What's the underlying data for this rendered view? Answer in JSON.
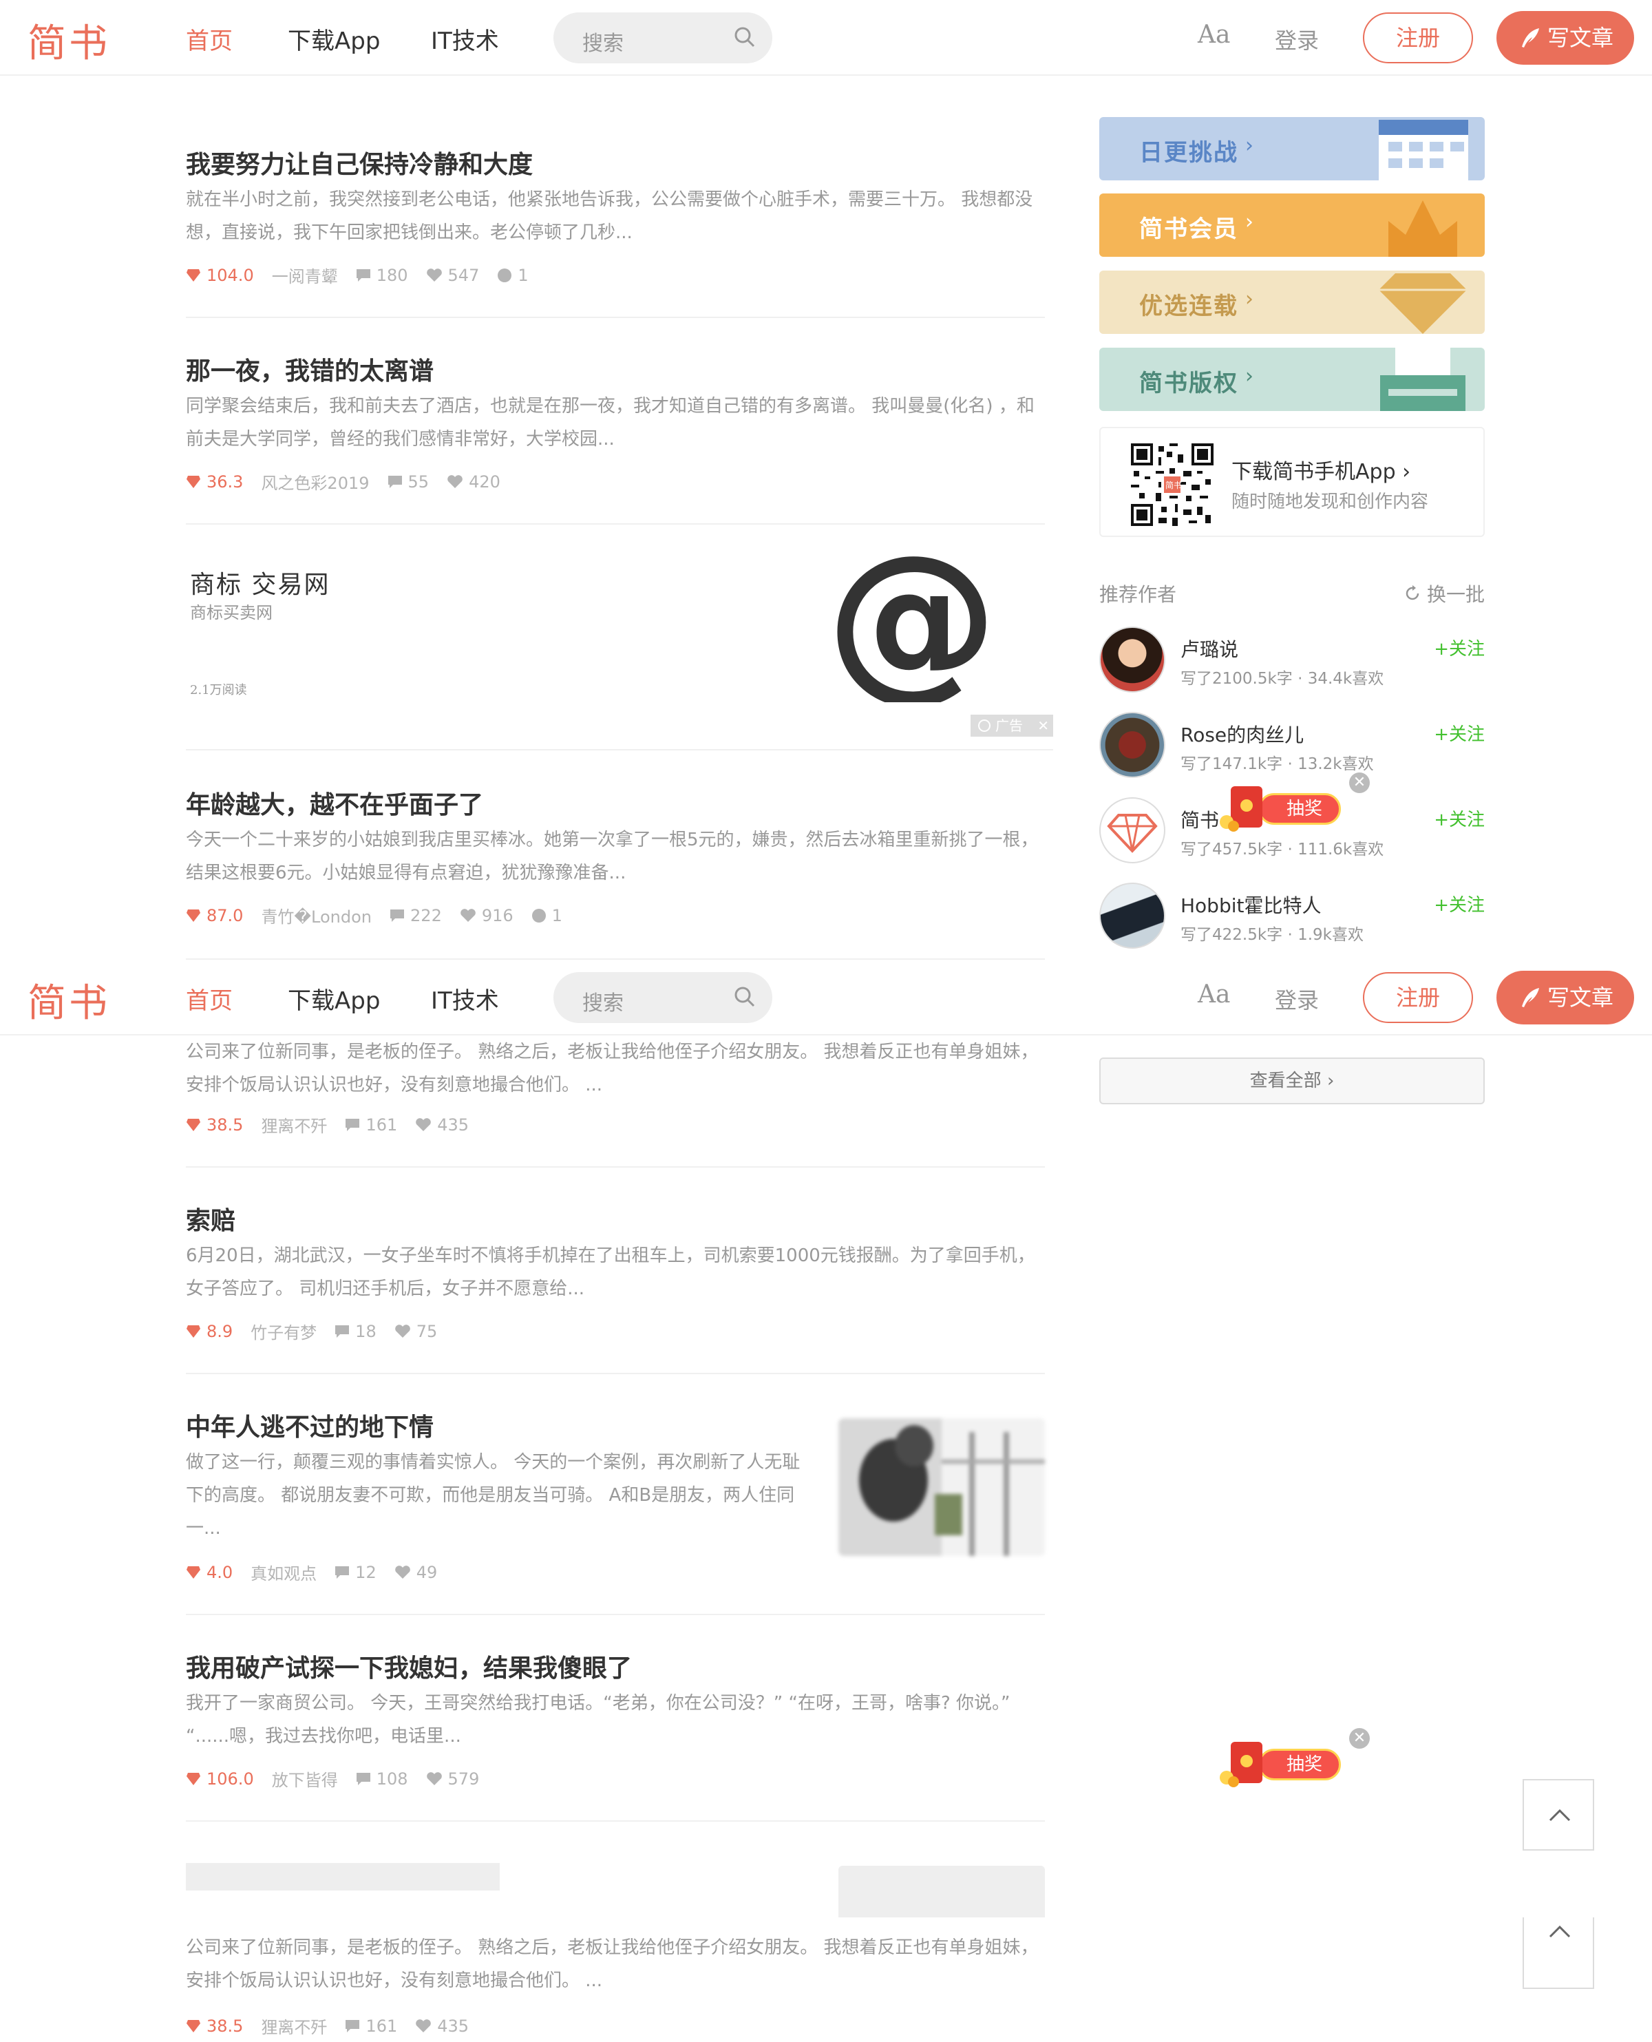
{
  "header": {
    "logo": "简书",
    "nav": [
      "首页",
      "下载App",
      "IT技术"
    ],
    "search_placeholder": "搜索",
    "font_toggle": "Aa",
    "login": "登录",
    "register": "注册",
    "write": "写文章"
  },
  "articles_top": [
    {
      "title": "我要努力让自己保持冷静和大度",
      "abstract": "就在半小时之前，我突然接到老公电话，他紧张地告诉我，公公需要做个心脏手术，需要三十万。 我想都没想，直接说，我下午回家把钱倒出来。老公停顿了几秒...",
      "money": "104.0",
      "author": "一阅青颦",
      "comments": "180",
      "likes": "547",
      "rewards": "1"
    },
    {
      "title": "那一夜，我错的太离谱",
      "abstract": "同学聚会结束后，我和前夫去了酒店，也就是在那一夜，我才知道自己错的有多离谱。 我叫曼曼(化名) ，和前夫是大学同学，曾经的我们感情非常好，大学校园...",
      "money": "36.3",
      "author": "风之色彩2019",
      "comments": "55",
      "likes": "420"
    },
    {
      "title": "年龄越大，越不在乎面子了",
      "abstract": "今天一个二十来岁的小姑娘到我店里买棒冰。她第一次拿了一根5元的，嫌贵，然后去冰箱里重新挑了一根，结果这根要6元。小姑娘显得有点窘迫，犹犹豫豫准备...",
      "money": "87.0",
      "author": "青竹�London",
      "comments": "222",
      "likes": "916",
      "rewards": "1"
    }
  ],
  "ad": {
    "title": "商标 交易网",
    "subtitle": "商标买卖网",
    "reads": "2.1万阅读",
    "badge": "广告"
  },
  "articles_mid": [
    {
      "abstract": "公司来了位新同事，是老板的侄子。 熟络之后，老板让我给他侄子介绍女朋友。 我想着反正也有单身姐妹，安排个饭局认识认识也好，没有刻意地撮合他们。 ...",
      "money": "38.5",
      "author": "狸离不歼",
      "comments": "161",
      "likes": "435"
    },
    {
      "title": "索赔",
      "abstract": "6月20日，湖北武汉，一女子坐车时不慎将手机掉在了出租车上，司机索要1000元钱报酬。为了拿回手机，女子答应了。 司机归还手机后，女子并不愿意给...",
      "money": "8.9",
      "author": "竹子有梦",
      "comments": "18",
      "likes": "75"
    },
    {
      "title": "中年人逃不过的地下情",
      "abstract": "做了这一行，颠覆三观的事情着实惊人。 今天的一个案例，再次刷新了人无耻下的高度。 都说朋友妻不可欺，而他是朋友当可骑。 A和B是朋友，两人住同一...",
      "money": "4.0",
      "author": "真如观点",
      "comments": "12",
      "likes": "49"
    },
    {
      "title": "我用破产试探一下我媳妇，结果我傻眼了",
      "abstract": "我开了一家商贸公司。 今天，王哥突然给我打电话。“老弟，你在公司没？” “在呀，王哥，啥事? 你说。” “......嗯，我过去找你吧，电话里...",
      "money": "106.0",
      "author": "放下皆得",
      "comments": "108",
      "likes": "579"
    }
  ],
  "articles_bottom": [
    {
      "abstract": "公司来了位新同事，是老板的侄子。 熟络之后，老板让我给他侄子介绍女朋友。 我想着反正也有单身姐妹，安排个饭局认识认识也好，没有刻意地撮合他们。 ...",
      "money": "38.5",
      "author": "狸离不歼",
      "comments": "161",
      "likes": "435"
    }
  ],
  "sidebar": {
    "banners": [
      {
        "label": "日更挑战",
        "color": "#5a86c6",
        "bg": "#bdd0ea"
      },
      {
        "label": "简书会员",
        "color": "#ffffff",
        "bg": "#f5b556"
      },
      {
        "label": "优选连载",
        "color": "#c49a4f",
        "bg": "#f3e4c2"
      },
      {
        "label": "简书版权",
        "color": "#4e8a7a",
        "bg": "#c8e2da"
      }
    ],
    "download": {
      "title": "下载简书手机App",
      "subtitle": "随时随地发现和创作内容",
      "qr_label": "简书"
    },
    "recommend_title": "推荐作者",
    "refresh": "换一批",
    "authors": [
      {
        "name": "卢璐说",
        "stats": "写了2100.5k字 · 34.4k喜欢",
        "follow": "+关注"
      },
      {
        "name": "Rose的肉丝儿",
        "stats": "写了147.1k字 · 13.2k喜欢",
        "follow": "+关注"
      },
      {
        "name": "简书",
        "stats": "写了457.5k字 · 111.6k喜欢",
        "follow": "+关注"
      },
      {
        "name": "Hobbit霍比特人",
        "stats": "写了422.5k字 · 1.9k喜欢",
        "follow": "+关注"
      }
    ],
    "see_all": "查看全部",
    "lottery": "抽奖"
  }
}
